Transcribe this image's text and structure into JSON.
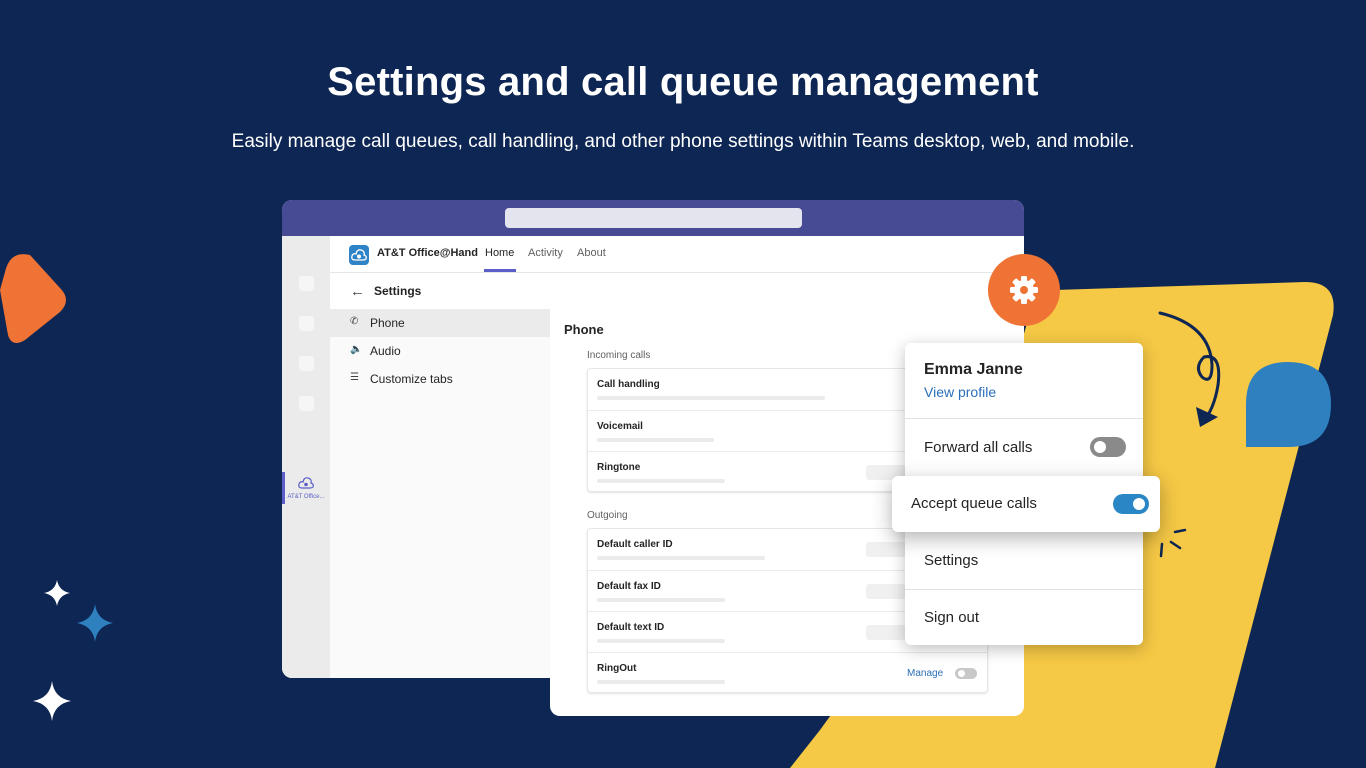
{
  "hero": {
    "title": "Settings and call queue management",
    "subtitle": "Easily manage call queues, call handling, and other phone settings within Teams desktop, web, and mobile."
  },
  "colors": {
    "background": "#0d2653",
    "accent_yellow": "#f5c845",
    "accent_orange": "#ef7334",
    "accent_blue": "#2e80bf",
    "teams_purple": "#464b93"
  },
  "teams": {
    "app_name": "AT&T Office@Hand",
    "rail_app_label": "AT&T Office...",
    "tabs": [
      {
        "label": "Home",
        "active": true
      },
      {
        "label": "Activity",
        "active": false
      },
      {
        "label": "About",
        "active": false
      }
    ],
    "settings_title": "Settings",
    "nav": [
      {
        "label": "Phone",
        "icon": "phone-icon",
        "active": true
      },
      {
        "label": "Audio",
        "icon": "speaker-icon",
        "active": false
      },
      {
        "label": "Customize tabs",
        "icon": "menu-lines-icon",
        "active": false
      }
    ]
  },
  "phone": {
    "title": "Phone",
    "incoming_label": "Incoming calls",
    "incoming": [
      "Call handling",
      "Voicemail",
      "Ringtone"
    ],
    "outgoing_label": "Outgoing",
    "outgoing": [
      "Default caller ID",
      "Default fax ID",
      "Default text ID",
      "RingOut"
    ],
    "manage_label": "Manage",
    "ringout_enabled": false
  },
  "profile_menu": {
    "name": "Emma Janne",
    "view_profile": "View profile",
    "forward_all_calls": "Forward all calls",
    "forward_enabled": false,
    "accept_queue_calls": "Accept queue calls",
    "accept_queue_enabled": true,
    "settings": "Settings",
    "sign_out": "Sign out"
  }
}
